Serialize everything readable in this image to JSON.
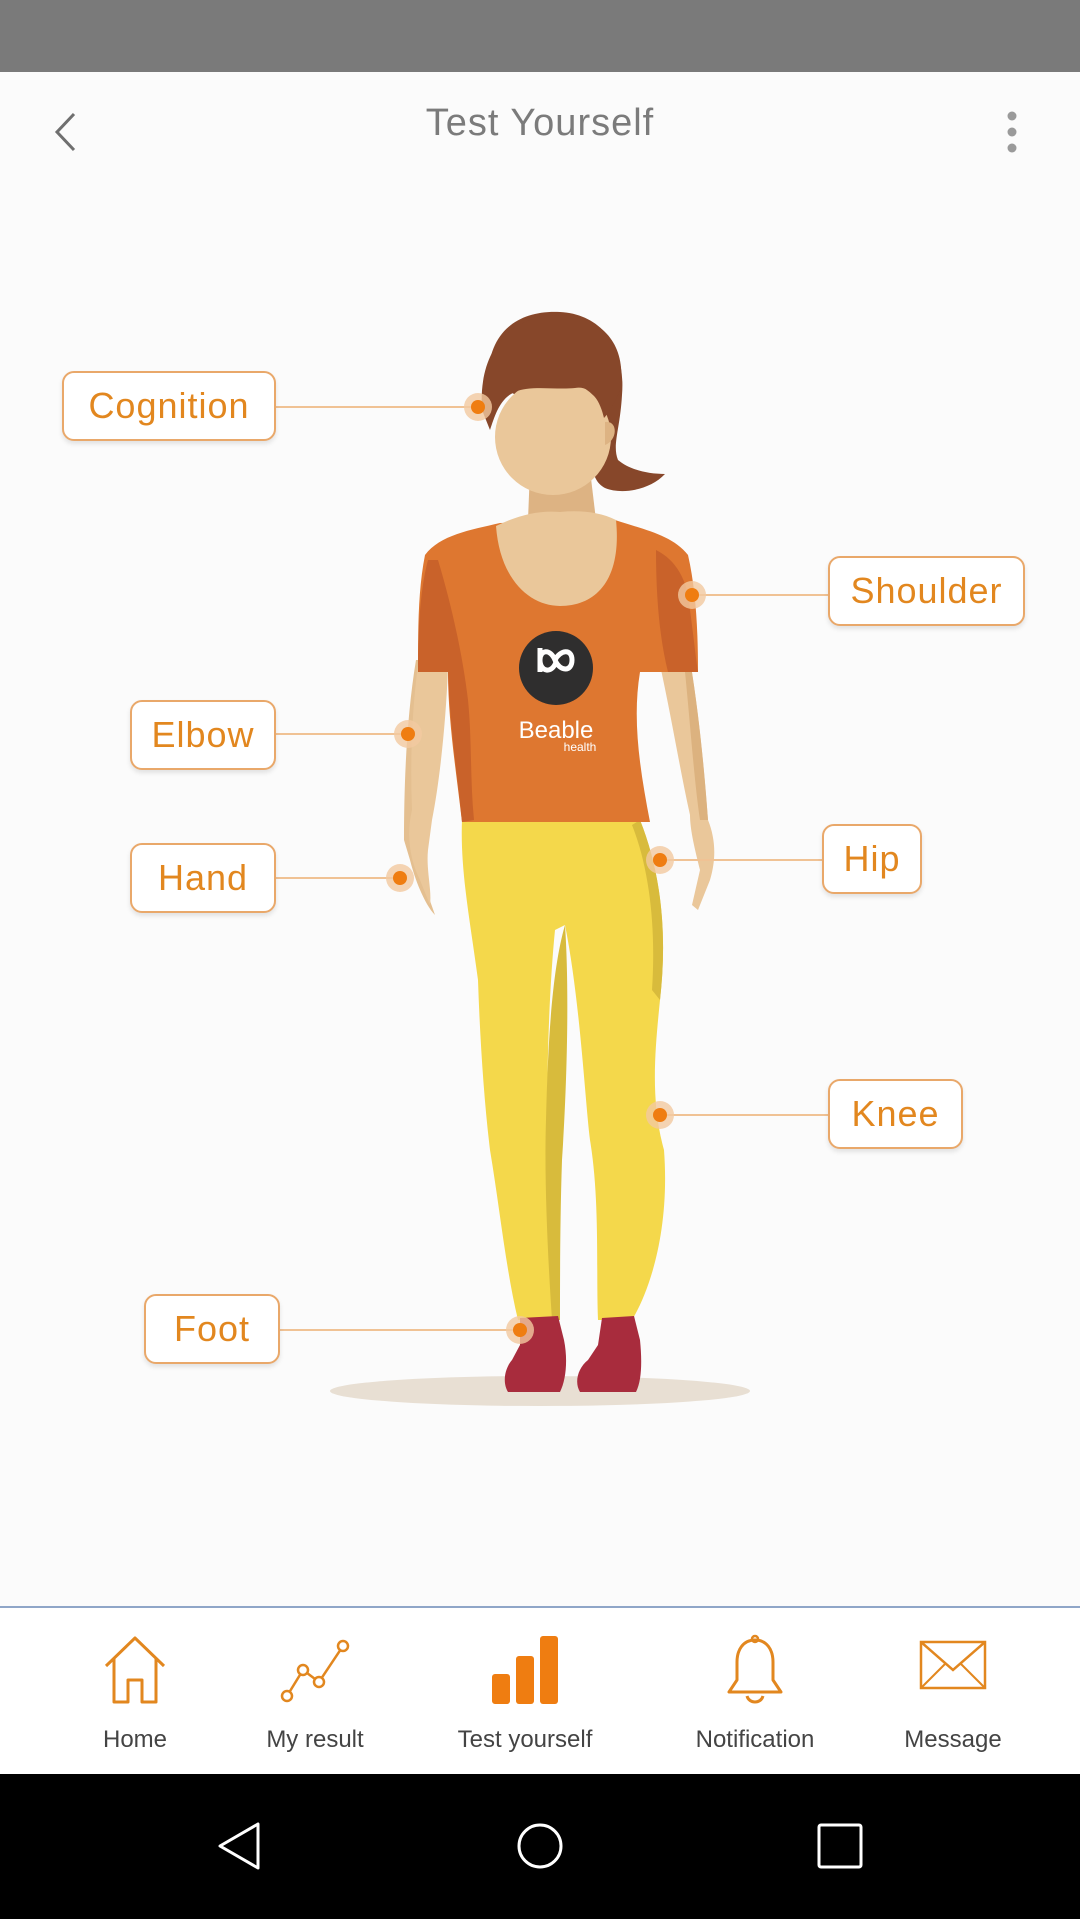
{
  "app_bar": {
    "title": "Test Yourself",
    "back_icon": "chevron-left-icon",
    "menu_icon": "more-vertical-icon"
  },
  "body_map": {
    "labels": {
      "cognition": "Cognition",
      "shoulder": "Shoulder",
      "elbow": "Elbow",
      "hand": "Hand",
      "hip": "Hip",
      "knee": "Knee",
      "foot": "Foot"
    },
    "shirt_logo": {
      "name": "Beable",
      "sub": "health"
    }
  },
  "bottom_nav": {
    "items": [
      {
        "label": "Home",
        "icon": "home-icon"
      },
      {
        "label": "My result",
        "icon": "line-chart-icon"
      },
      {
        "label": "Test yourself",
        "icon": "bar-chart-icon",
        "active": true
      },
      {
        "label": "Notification",
        "icon": "bell-icon"
      },
      {
        "label": "Message",
        "icon": "envelope-icon"
      }
    ]
  },
  "colors": {
    "accent": "#e2871f",
    "label_border": "#e9a86a",
    "shirt": "#de7730",
    "pants": "#f4d84b",
    "hair": "#87472a",
    "shoes": "#a82c3d",
    "skin": "#eac79a"
  }
}
